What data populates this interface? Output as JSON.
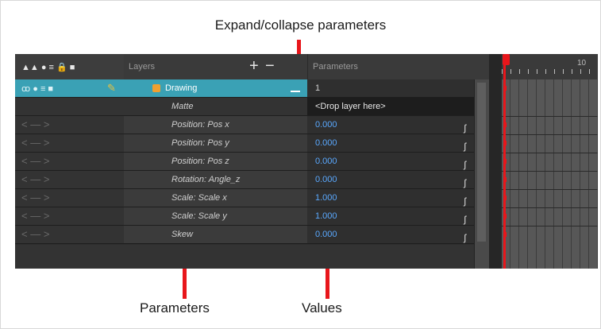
{
  "callouts": {
    "expand_collapse": "Expand/collapse parameters",
    "parameters": "Parameters",
    "values": "Values"
  },
  "header": {
    "layers_label": "Layers",
    "parameters_label": "Parameters",
    "timeline_frame": "10",
    "toggle_icons": "▲▲ ● ≡ 🔒 ■",
    "add_icon": "+",
    "remove_icon": "−"
  },
  "layer": {
    "name": "Drawing",
    "value": "1",
    "toggle_icons": "ꝏ ● ≡ ■"
  },
  "matte": {
    "label": "Matte",
    "value": "<Drop layer here>"
  },
  "params": [
    {
      "label": "Position: Pos x",
      "value": "0.000"
    },
    {
      "label": "Position: Pos y",
      "value": "0.000"
    },
    {
      "label": "Position: Pos z",
      "value": "0.000"
    },
    {
      "label": "Rotation: Angle_z",
      "value": "0.000"
    },
    {
      "label": "Scale: Scale x",
      "value": "1.000"
    },
    {
      "label": "Scale: Scale y",
      "value": "1.000"
    },
    {
      "label": "Skew",
      "value": "0.000"
    }
  ],
  "nav_arrows": "< — >",
  "colors": {
    "accent": "#3aa1b5",
    "callout": "#e8161b",
    "value_text": "#5aa9ff"
  }
}
